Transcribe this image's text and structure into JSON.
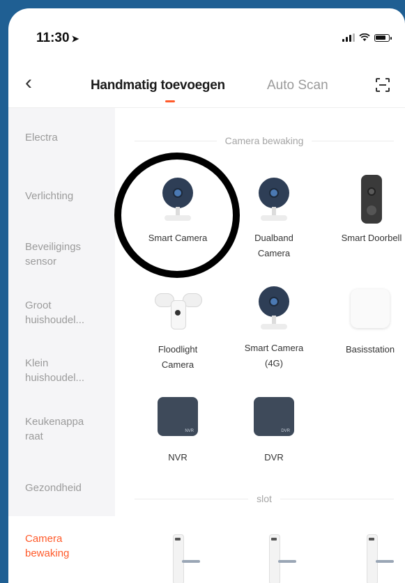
{
  "status_bar": {
    "time": "11:30",
    "battery_level": 0.85,
    "time_arrow": "➤"
  },
  "nav": {
    "back_icon": "‹",
    "tab_manual": "Handmatig toevoegen",
    "tab_auto": "Auto Scan",
    "accent_color": "#ff5a2a"
  },
  "sidebar": {
    "items": [
      {
        "label": "Electra"
      },
      {
        "label": "Verlichting"
      },
      {
        "label": "Beveiligings sensor"
      },
      {
        "label": "Groot huishoudel..."
      },
      {
        "label": "Klein huishoudel..."
      },
      {
        "label": "Keukenappa raat"
      },
      {
        "label": "Gezondheid"
      },
      {
        "label": "Camera bewaking"
      }
    ],
    "active_index": 7
  },
  "sections": [
    {
      "title": "Camera bewaking",
      "devices": [
        {
          "name": "Smart Camera",
          "icon": "camera-icon"
        },
        {
          "name": "Dualband Camera",
          "icon": "camera-icon"
        },
        {
          "name": "Smart Doorbell",
          "icon": "doorbell-icon"
        },
        {
          "name": "Floodlight Camera",
          "icon": "floodlight-icon"
        },
        {
          "name": "Smart Camera (4G)",
          "icon": "camera-icon"
        },
        {
          "name": "Basisstation",
          "icon": "base-station-icon"
        },
        {
          "name": "NVR",
          "icon": "nvr-icon",
          "tag": "NVR"
        },
        {
          "name": "DVR",
          "icon": "dvr-icon",
          "tag": "DVR"
        }
      ]
    },
    {
      "title": "slot",
      "devices": [
        {
          "name": "",
          "icon": "door-lock-icon"
        },
        {
          "name": "",
          "icon": "door-lock-icon"
        },
        {
          "name": "",
          "icon": "door-lock-icon"
        }
      ]
    }
  ]
}
